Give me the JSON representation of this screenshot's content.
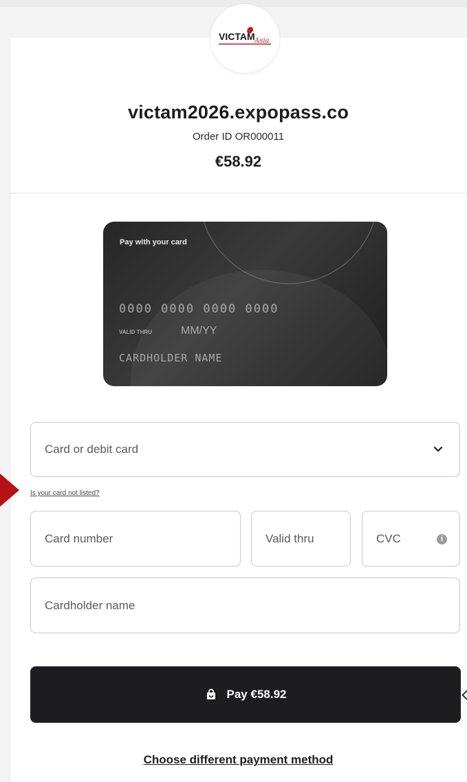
{
  "brand": {
    "logo_text": "VICTAM",
    "logo_script": "Asia"
  },
  "merchant": {
    "name": "victam2026.expopass.co",
    "order_id": "Order ID OR000011",
    "amount": "€58.92"
  },
  "card_preview": {
    "title": "Pay with your card",
    "number": "0000 0000 0000 0000",
    "valid_label": "VALID THRU",
    "valid_value": "MM/YY",
    "holder": "CARDHOLDER NAME"
  },
  "form": {
    "card_type": "Card or debit card",
    "not_listed": "Is your card not listed?",
    "card_number": "Card number",
    "valid_thru": "Valid thru",
    "cvc": "CVC",
    "cardholder_name": "Cardholder name"
  },
  "actions": {
    "pay_label": "Pay €58.92",
    "alt_method": "Choose different payment method"
  },
  "icons": {
    "chevron": "chevron-down-icon",
    "info": "info-icon",
    "bag": "shopping-bag-icon"
  },
  "colors": {
    "accent": "#1d1d1f",
    "card": "#2b2b2b",
    "marker": "#b31217",
    "logo_red": "#c41e24"
  }
}
